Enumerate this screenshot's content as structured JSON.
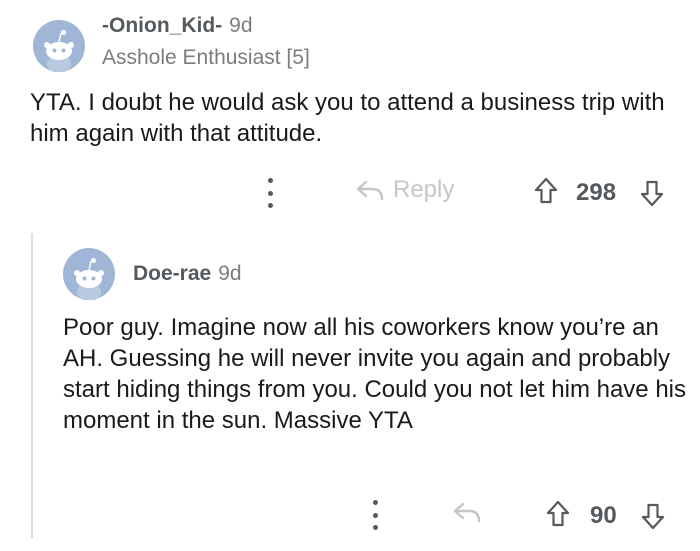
{
  "comment": {
    "author": "-Onion_Kid-",
    "age": "9d",
    "flair": "Asshole Enthusiast [5]",
    "body": "YTA. I doubt he would ask you to attend a business trip with him again with that attitude.",
    "reply_label": "Reply",
    "score": "298",
    "avatar_icon": "snoo-avatar-icon"
  },
  "reply": {
    "author": "Doe-rae",
    "age": "9d",
    "body": "Poor guy. Imagine now all his coworkers know you’re an AH. Guessing he will never invite you again and probably start hiding things from you. Could you not let him have his moment in the sun. Massive YTA",
    "score": "90",
    "avatar_icon": "snoo-avatar-icon"
  },
  "colors": {
    "avatar_bg": "#9fb6d6",
    "meta_text": "#7c7c7c",
    "icon_gray": "#555a5e",
    "reply_disabled": "#c4c6c8",
    "thread_line": "#dcdde0"
  }
}
